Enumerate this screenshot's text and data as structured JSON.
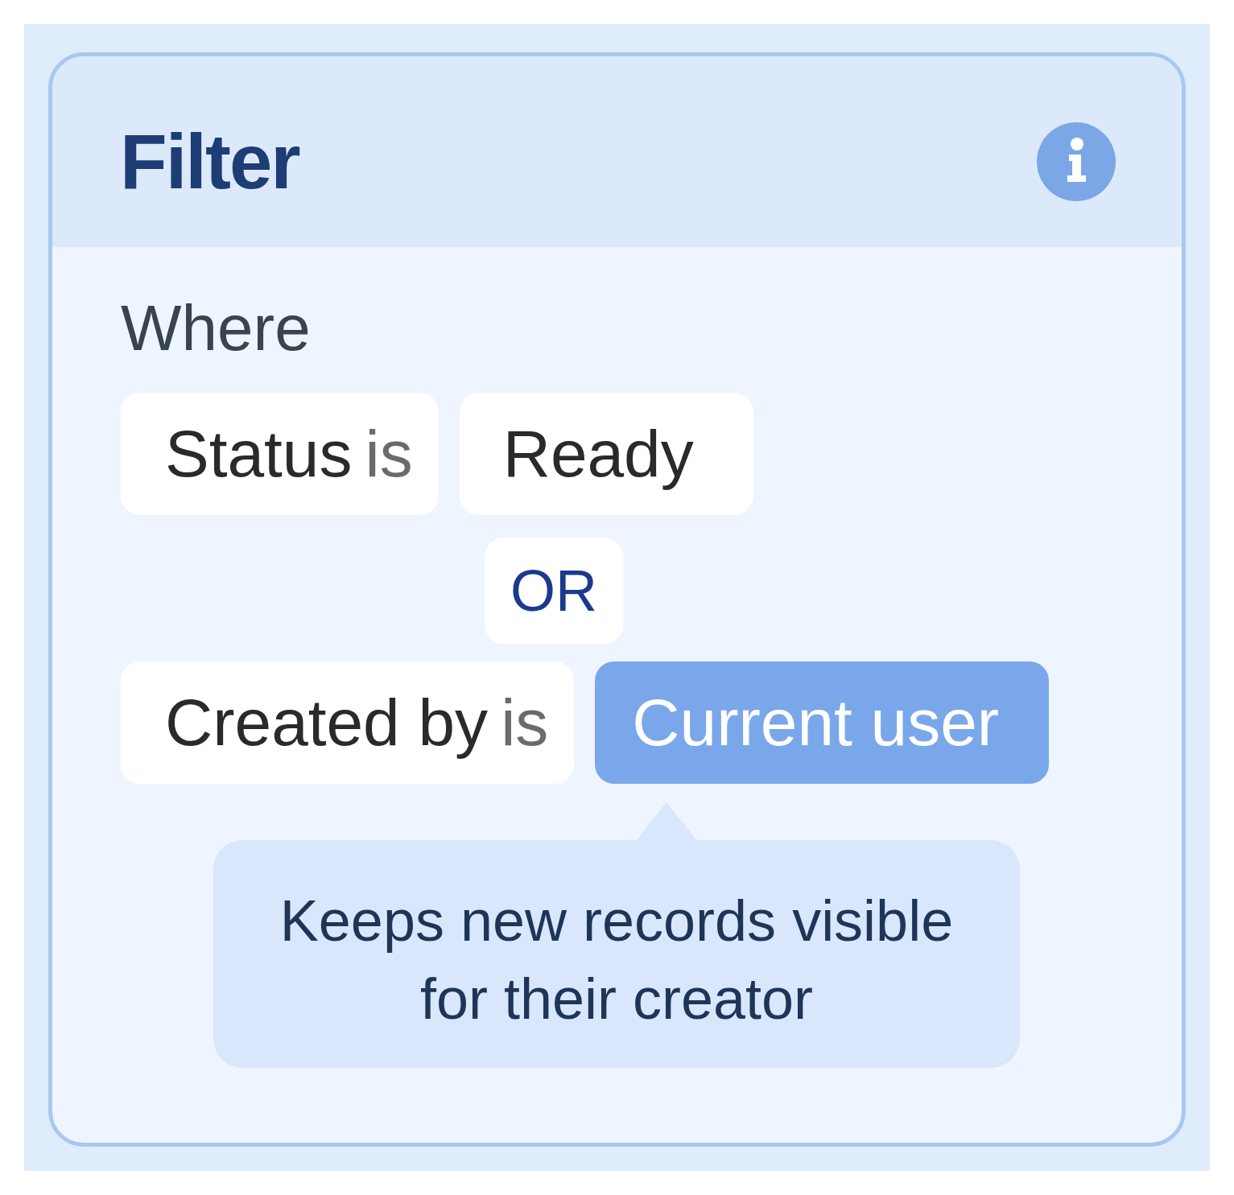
{
  "filter": {
    "title": "Filter",
    "label": "Where",
    "conditions": [
      {
        "field": "Status",
        "operator": "is",
        "value": "Ready",
        "selected": false
      },
      {
        "field": "Created by",
        "operator": "is",
        "value": "Current user",
        "selected": true
      }
    ],
    "connector": "OR",
    "tooltip": "Keeps new records visible for their creator"
  }
}
